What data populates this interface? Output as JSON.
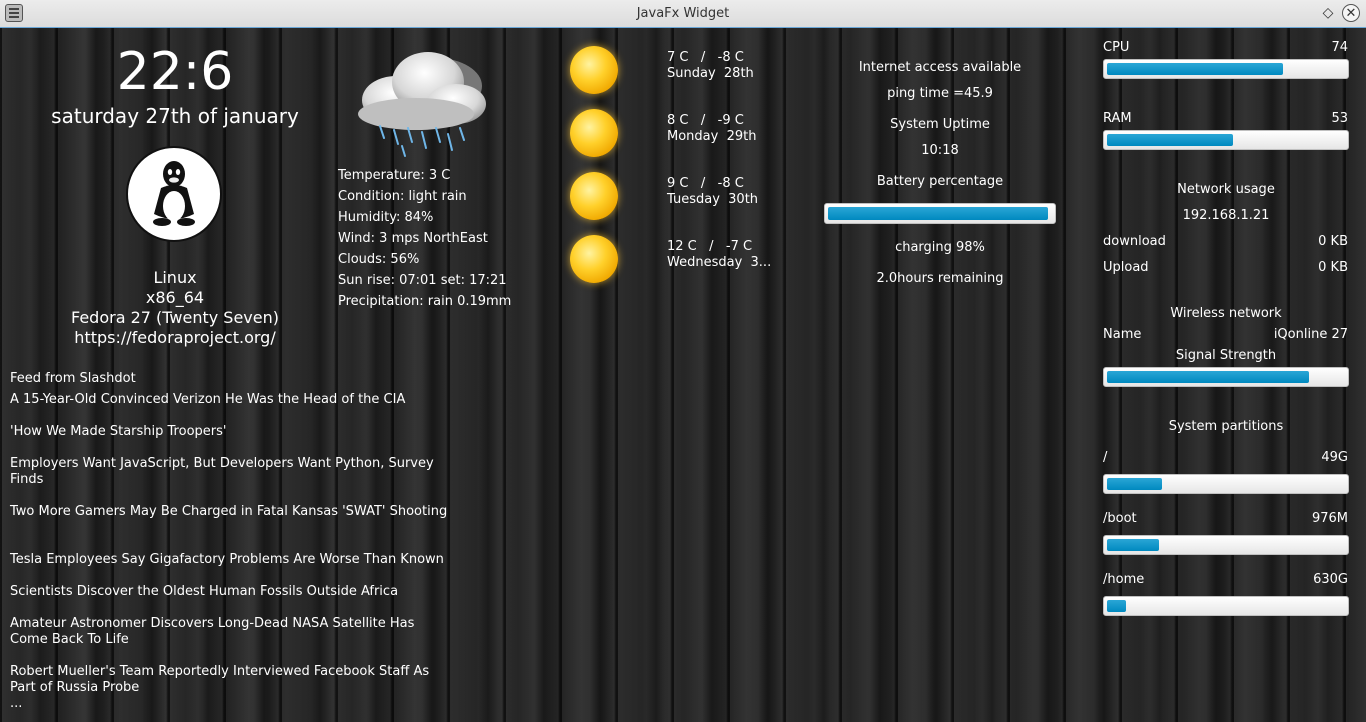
{
  "window": {
    "title": "JavaFx Widget"
  },
  "clock": {
    "time": "22:6",
    "date": "saturday 27th of january"
  },
  "os": {
    "name": "Linux",
    "arch": "x86_64",
    "distro": "Fedora  27 (Twenty Seven)",
    "url": "https://fedoraproject.org/"
  },
  "feed": {
    "title": "Feed from Slashdot",
    "items": [
      "A 15-Year-Old Convinced Verizon He Was the Head of the CIA",
      "'How We Made Starship Troopers'",
      "Employers Want JavaScript, But Developers Want Python, Survey Finds",
      "Two More Gamers May Be Charged in Fatal Kansas 'SWAT' Shooting",
      "Tesla Employees Say Gigafactory Problems Are Worse Than Known",
      "Scientists Discover the Oldest Human Fossils Outside Africa",
      "Amateur Astronomer Discovers Long-Dead NASA Satellite Has Come Back To Life",
      "Robert Mueller's Team Reportedly Interviewed Facebook Staff As Part of Russia Probe"
    ],
    "more": "..."
  },
  "weather": {
    "icon": "rain-cloud-icon",
    "lines": [
      "Temperature: 3 C",
      "Condition: light rain",
      "Humidity: 84%",
      "Wind: 3 mps NorthEast",
      "Clouds: 56%",
      "Sun rise: 07:01 set: 17:21",
      "Precipitation: rain  0.19mm"
    ]
  },
  "forecast": [
    {
      "temps": "7 C   /   -8 C",
      "day": "Sunday  28th",
      "icon": "sun-icon"
    },
    {
      "temps": "8 C   /   -9 C",
      "day": "Monday  29th",
      "icon": "sun-icon"
    },
    {
      "temps": "9 C   /   -8 C",
      "day": "Tuesday  30th",
      "icon": "sun-icon"
    },
    {
      "temps": "12 C   /   -7 C",
      "day": "Wednesday  3...",
      "icon": "sun-icon"
    }
  ],
  "system": {
    "internet": "Internet access available",
    "ping": "ping time =45.9",
    "uptime_label": "System Uptime",
    "uptime": "10:18",
    "battery_label": "Battery percentage",
    "battery_level": 0.98,
    "charging": "charging 98%",
    "remaining": "2.0hours remaining"
  },
  "resources": {
    "cpu_label": "CPU",
    "cpu_value": "74",
    "cpu_level": 0.74,
    "ram_label": "RAM",
    "ram_value": "53",
    "ram_level": 0.53
  },
  "network": {
    "title": "Network usage",
    "ip": "192.168.1.21",
    "download_label": "download",
    "download_value": "0 KB",
    "upload_label": "Upload",
    "upload_value": "0 KB"
  },
  "wireless": {
    "title": "Wireless network",
    "name_label": "Name",
    "name_value": "iQonline 27",
    "strength_label": "Signal Strength",
    "strength_level": 0.85
  },
  "partitions": {
    "title": "System partitions",
    "items": [
      {
        "mount": "/",
        "size": "49G",
        "level": 0.23
      },
      {
        "mount": "/boot",
        "size": "976M",
        "level": 0.22
      },
      {
        "mount": "/home",
        "size": "630G",
        "level": 0.08
      }
    ]
  }
}
